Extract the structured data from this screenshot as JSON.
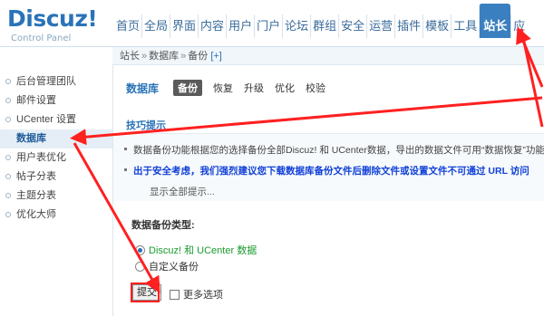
{
  "logo": {
    "title": "Discuz!",
    "subtitle": "Control Panel"
  },
  "topnav": [
    {
      "label": "首页",
      "active": false
    },
    {
      "label": "全局",
      "active": false
    },
    {
      "label": "界面",
      "active": false
    },
    {
      "label": "内容",
      "active": false
    },
    {
      "label": "用户",
      "active": false
    },
    {
      "label": "门户",
      "active": false
    },
    {
      "label": "论坛",
      "active": false
    },
    {
      "label": "群组",
      "active": false
    },
    {
      "label": "安全",
      "active": false
    },
    {
      "label": "运营",
      "active": false
    },
    {
      "label": "插件",
      "active": false
    },
    {
      "label": "模板",
      "active": false
    },
    {
      "label": "工具",
      "active": false
    },
    {
      "label": "站长",
      "active": true
    },
    {
      "label": "应",
      "active": false
    }
  ],
  "breadcrumb": {
    "item1": "站长",
    "sep1": "»",
    "item2": "数据库",
    "sep2": "»",
    "item3": "备份",
    "link": "[+]"
  },
  "sidebar": {
    "items": [
      {
        "label": "后台管理团队",
        "active": false
      },
      {
        "label": "邮件设置",
        "active": false
      },
      {
        "label": "UCenter 设置",
        "active": false
      },
      {
        "label": "数据库",
        "active": true
      },
      {
        "label": "用户表优化",
        "active": false
      },
      {
        "label": "帖子分表",
        "active": false
      },
      {
        "label": "主题分表",
        "active": false
      },
      {
        "label": "优化大师",
        "active": false
      }
    ]
  },
  "main": {
    "title": "数据库",
    "tabs": [
      {
        "label": "备份",
        "active": true
      },
      {
        "label": "恢复",
        "active": false
      },
      {
        "label": "升级",
        "active": false
      },
      {
        "label": "优化",
        "active": false
      },
      {
        "label": "校验",
        "active": false
      }
    ],
    "tips_header": "技巧提示",
    "tips": [
      "数据备份功能根据您的选择备份全部Discuz! 和 UCenter数据，导出的数据文件可用“数据恢复”功能或",
      "出于安全考虑，我们强烈建议您下载数据库备份文件后删除文件或设置文件不可通过 URL 访问",
      "显示全部提示..."
    ],
    "backup_type_label": "数据备份类型:",
    "options": [
      {
        "label": "Discuz! 和 UCenter 数据",
        "checked": true
      },
      {
        "label": "自定义备份",
        "checked": false
      }
    ],
    "submit_label": "提交",
    "more_options_label": "更多选项"
  },
  "colors": {
    "accent": "#2a73b8",
    "annotation": "#ff2020",
    "green": "#1a9a30",
    "tip_blue": "#1040d8"
  }
}
